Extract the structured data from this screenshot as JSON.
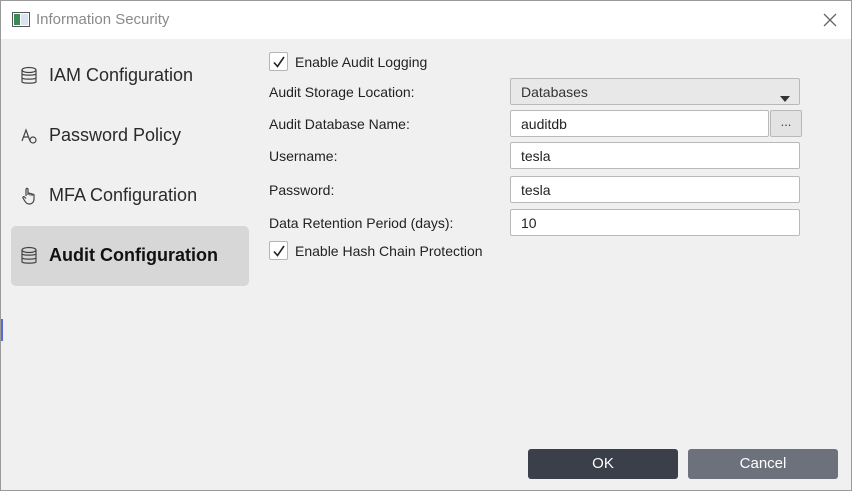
{
  "window": {
    "title": "Information Security"
  },
  "sidebar": {
    "items": [
      {
        "label": "IAM Configuration",
        "icon": "database-icon",
        "active": false
      },
      {
        "label": "Password Policy",
        "icon": "text-cursor-icon",
        "active": false
      },
      {
        "label": "MFA Configuration",
        "icon": "hand-pointer-icon",
        "active": false
      },
      {
        "label": "Audit Configuration",
        "icon": "database-icon",
        "active": true
      }
    ]
  },
  "form": {
    "enable_audit_logging": {
      "label": "Enable Audit Logging",
      "checked": true
    },
    "storage_location": {
      "label": "Audit Storage Location:",
      "value": "Databases"
    },
    "database_name": {
      "label": "Audit Database Name:",
      "value": "auditdb",
      "browse_label": "..."
    },
    "username": {
      "label": "Username:",
      "value": "tesla"
    },
    "password": {
      "label": "Password:",
      "value": "tesla"
    },
    "retention": {
      "label": "Data Retention Period (days):",
      "value": "10"
    },
    "hash_chain": {
      "label": "Enable Hash Chain Protection",
      "checked": true
    }
  },
  "buttons": {
    "ok": "OK",
    "cancel": "Cancel"
  },
  "colors": {
    "ok_button": "#3b3f4a",
    "cancel_button": "#6c717b",
    "active_item": "#d7d7d7"
  }
}
